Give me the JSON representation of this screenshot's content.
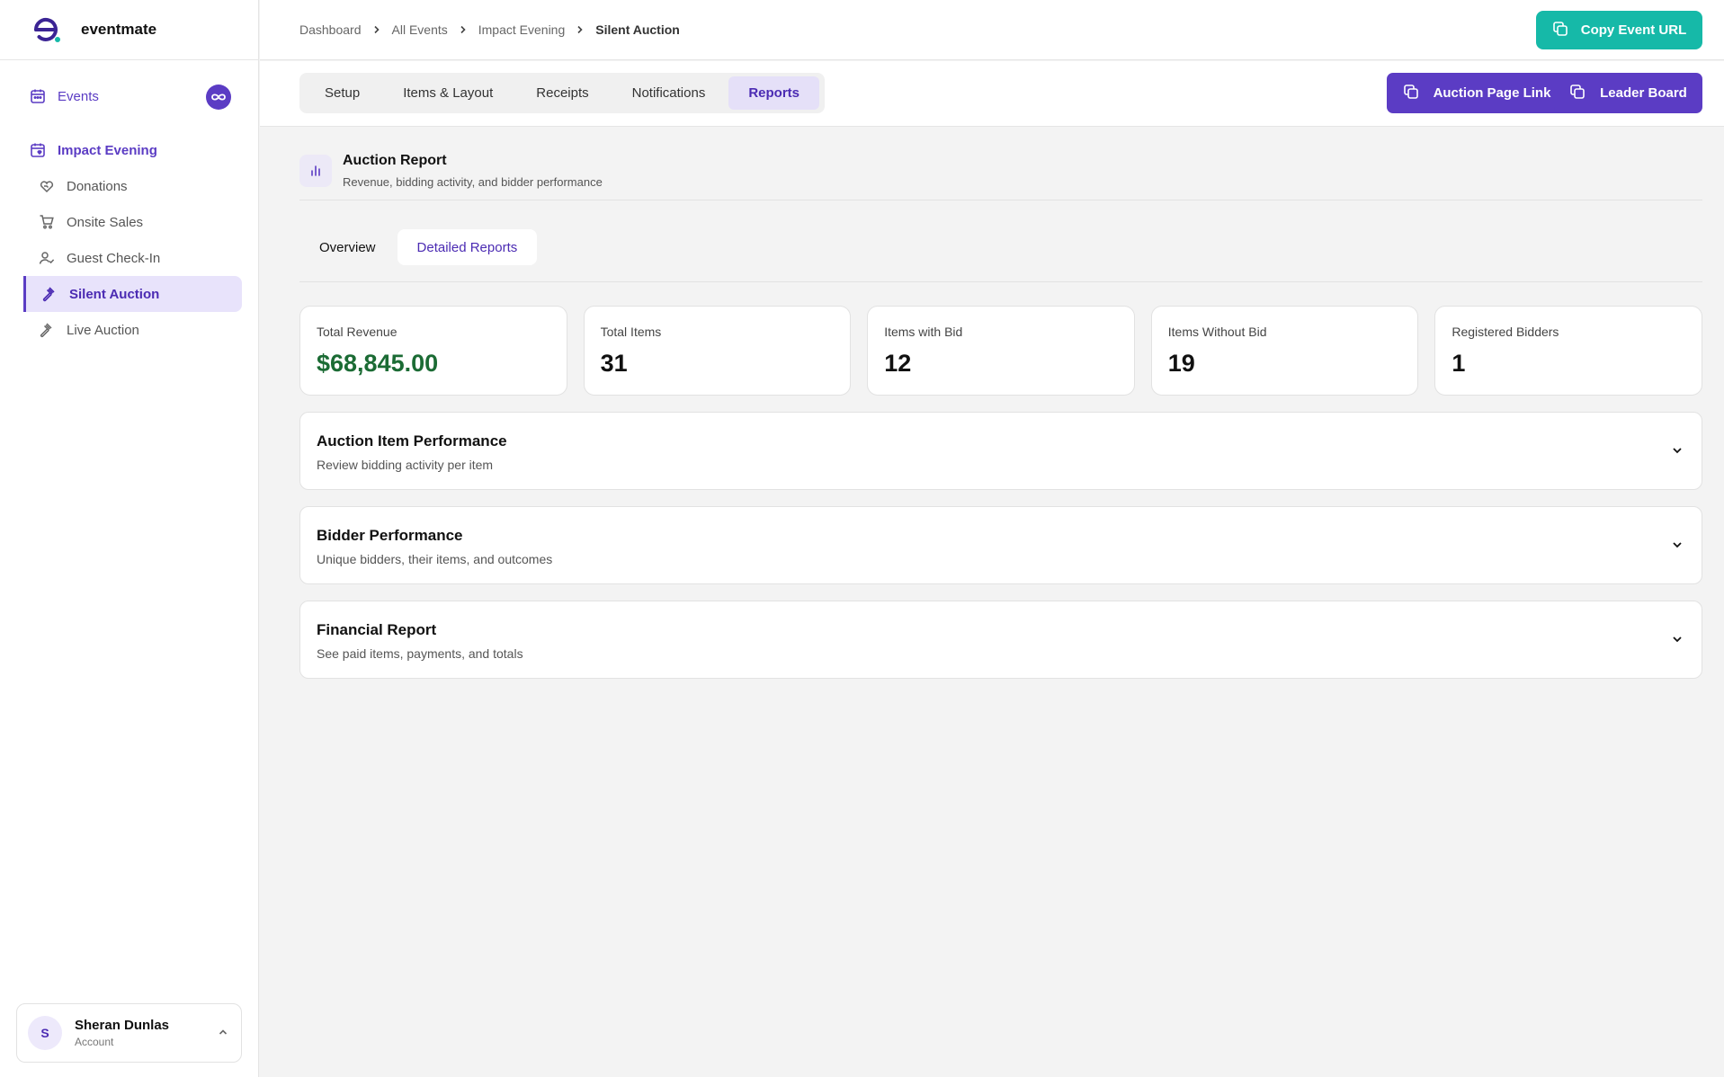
{
  "brand": {
    "name": "eventmate"
  },
  "sidebar": {
    "events_label": "Events",
    "event_title": "Impact Evening",
    "items": [
      {
        "label": "Donations",
        "icon": "heart-hand-icon"
      },
      {
        "label": "Onsite Sales",
        "icon": "cart-icon"
      },
      {
        "label": "Guest Check-In",
        "icon": "user-check-icon"
      },
      {
        "label": "Silent Auction",
        "icon": "gavel-icon",
        "active": true
      },
      {
        "label": "Live Auction",
        "icon": "gavel-icon"
      }
    ],
    "account": {
      "initial": "S",
      "name": "Sheran Dunlas",
      "role": "Account"
    }
  },
  "breadcrumb": {
    "items": [
      "Dashboard",
      "All Events",
      "Impact Evening"
    ],
    "current": "Silent Auction"
  },
  "header": {
    "copy_url_label": "Copy Event URL"
  },
  "tabs": {
    "items": [
      "Setup",
      "Items & Layout",
      "Receipts",
      "Notifications",
      "Reports"
    ],
    "active": "Reports"
  },
  "actions": {
    "auction_link_label": "Auction Page Link",
    "leaderboard_label": "Leader Board"
  },
  "report": {
    "title": "Auction Report",
    "subtitle": "Revenue, bidding activity, and bidder performance",
    "subtabs": [
      "Overview",
      "Detailed Reports"
    ],
    "active_subtab": "Detailed Reports"
  },
  "stats": [
    {
      "label": "Total Revenue",
      "value": "$68,845.00"
    },
    {
      "label": "Total Items",
      "value": "31"
    },
    {
      "label": "Items with Bid",
      "value": "12"
    },
    {
      "label": "Items Without Bid",
      "value": "19"
    },
    {
      "label": "Registered Bidders",
      "value": "1"
    }
  ],
  "sections": [
    {
      "title": "Auction Item Performance",
      "desc": "Review bidding activity per item"
    },
    {
      "title": "Bidder Performance",
      "desc": "Unique bidders, their items, and outcomes"
    },
    {
      "title": "Financial Report",
      "desc": "See paid items, payments, and totals"
    }
  ],
  "colors": {
    "accent": "#5b3cc4",
    "teal": "#16b9a8",
    "money": "#1b6b34"
  }
}
